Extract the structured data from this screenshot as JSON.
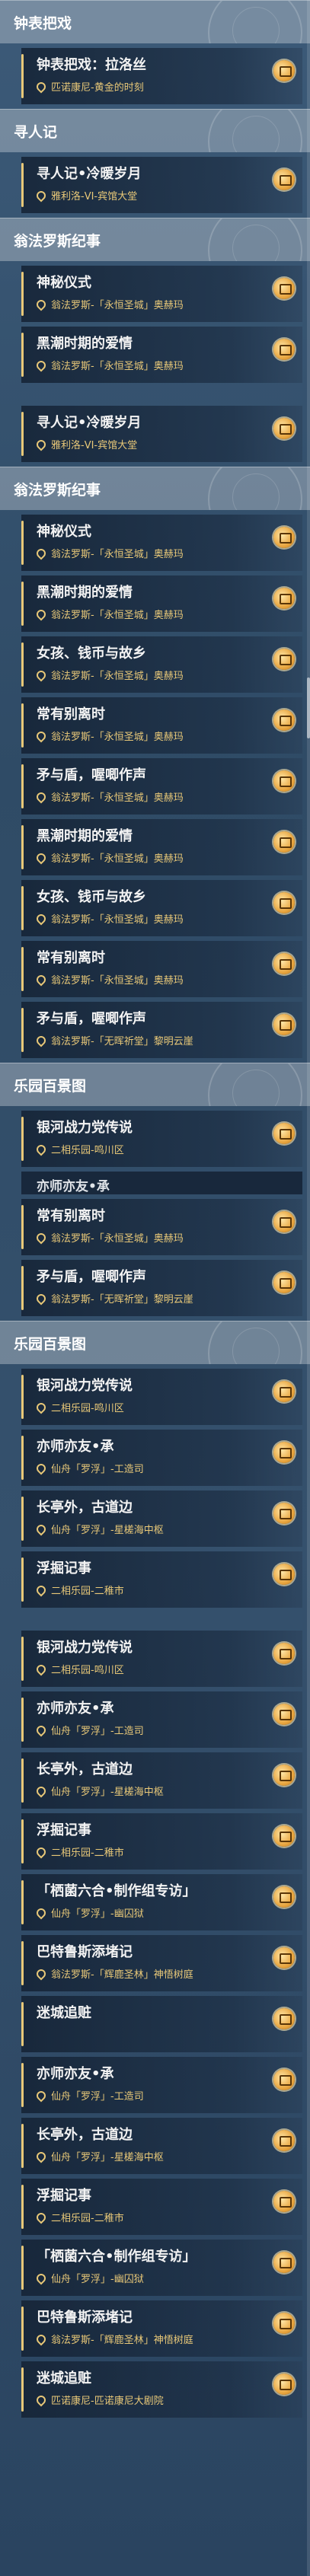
{
  "blocks": [
    {
      "type": "section",
      "label": "钟表把戏"
    },
    {
      "type": "card",
      "title": "钟表把戏：拉洛丝",
      "location": "匹诺康尼-黄金的时刻"
    },
    {
      "type": "section",
      "label": "寻人记"
    },
    {
      "type": "card",
      "title": "寻人记•冷暖岁月",
      "location": "雅利洛-VI-宾馆大堂"
    },
    {
      "type": "section",
      "label": "翁法罗斯纪事"
    },
    {
      "type": "card",
      "title": "神秘仪式",
      "location": "翁法罗斯-「永恒圣城」奥赫玛"
    },
    {
      "type": "card",
      "title": "黑潮时期的爱情",
      "location": "翁法罗斯-「永恒圣城」奥赫玛"
    },
    {
      "type": "spacer"
    },
    {
      "type": "card",
      "title": "寻人记•冷暖岁月",
      "location": "雅利洛-VI-宾馆大堂"
    },
    {
      "type": "section",
      "label": "翁法罗斯纪事"
    },
    {
      "type": "card",
      "title": "神秘仪式",
      "location": "翁法罗斯-「永恒圣城」奥赫玛"
    },
    {
      "type": "card",
      "title": "黑潮时期的爱情",
      "location": "翁法罗斯-「永恒圣城」奥赫玛"
    },
    {
      "type": "card",
      "title": "女孩、钱币与故乡",
      "location": "翁法罗斯-「永恒圣城」奥赫玛"
    },
    {
      "type": "card",
      "title": "常有别离时",
      "location": "翁法罗斯-「永恒圣城」奥赫玛"
    },
    {
      "type": "card",
      "title": "矛与盾，喔唧作声",
      "location": "翁法罗斯-「永恒圣城」奥赫玛"
    },
    {
      "type": "card",
      "title": "黑潮时期的爱情",
      "location": "翁法罗斯-「永恒圣城」奥赫玛"
    },
    {
      "type": "card",
      "title": "女孩、钱币与故乡",
      "location": "翁法罗斯-「永恒圣城」奥赫玛"
    },
    {
      "type": "card",
      "title": "常有别离时",
      "location": "翁法罗斯-「永恒圣城」奥赫玛"
    },
    {
      "type": "card",
      "title": "矛与盾，喔唧作声",
      "location": "翁法罗斯-「无晖祈堂」黎明云崖"
    },
    {
      "type": "section",
      "label": "乐园百景图"
    },
    {
      "type": "card",
      "title": "银河战力党传说",
      "location": "二相乐园-鸣川区"
    },
    {
      "type": "partial",
      "title": "亦师亦友•承"
    },
    {
      "type": "card",
      "title": "常有别离时",
      "location": "翁法罗斯-「永恒圣城」奥赫玛"
    },
    {
      "type": "card",
      "title": "矛与盾，喔唧作声",
      "location": "翁法罗斯-「无晖祈堂」黎明云崖"
    },
    {
      "type": "section",
      "label": "乐园百景图"
    },
    {
      "type": "card",
      "title": "银河战力党传说",
      "location": "二相乐园-鸣川区"
    },
    {
      "type": "card",
      "title": "亦师亦友•承",
      "location": "仙舟「罗浮」-工造司"
    },
    {
      "type": "card",
      "title": "长亭外，古道边",
      "location": "仙舟「罗浮」-星槎海中枢"
    },
    {
      "type": "card",
      "title": "浮掘记事",
      "location": "二相乐园-二稚市"
    },
    {
      "type": "spacer"
    },
    {
      "type": "card",
      "title": "银河战力党传说",
      "location": "二相乐园-鸣川区"
    },
    {
      "type": "card",
      "title": "亦师亦友•承",
      "location": "仙舟「罗浮」-工造司"
    },
    {
      "type": "card",
      "title": "长亭外，古道边",
      "location": "仙舟「罗浮」-星槎海中枢"
    },
    {
      "type": "card",
      "title": "浮掘记事",
      "location": "二相乐园-二稚市"
    },
    {
      "type": "card",
      "title": "「栖菌六合•制作组专访」",
      "location": "仙舟「罗浮」-幽囚狱"
    },
    {
      "type": "card",
      "title": "巴特鲁斯添堵记",
      "location": "翁法罗斯-「辉鹿圣林」神悟树庭"
    },
    {
      "type": "card",
      "title": "迷城追赃",
      "location": ""
    },
    {
      "type": "card",
      "title": "亦师亦友•承",
      "location": "仙舟「罗浮」-工造司"
    },
    {
      "type": "card",
      "title": "长亭外，古道边",
      "location": "仙舟「罗浮」-星槎海中枢"
    },
    {
      "type": "card",
      "title": "浮掘记事",
      "location": "二相乐园-二稚市"
    },
    {
      "type": "card",
      "title": "「栖菌六合•制作组专访」",
      "location": "仙舟「罗浮」-幽囚狱"
    },
    {
      "type": "card",
      "title": "巴特鲁斯添堵记",
      "location": "翁法罗斯-「辉鹿圣林」神悟树庭"
    },
    {
      "type": "card",
      "title": "迷城追赃",
      "location": "匹诺康尼-匹诺康尼大剧院"
    }
  ]
}
